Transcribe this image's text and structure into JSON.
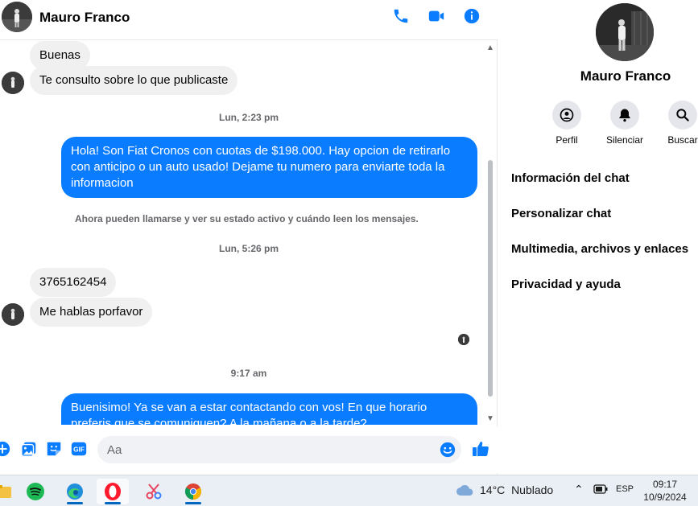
{
  "chat": {
    "contact_name": "Mauro Franco",
    "messages": [
      {
        "dir": "in",
        "text": "Buenas"
      },
      {
        "dir": "in",
        "text": "Te consulto sobre lo que publicaste"
      },
      {
        "type": "time",
        "text": "Lun, 2:23 pm"
      },
      {
        "dir": "out",
        "text": "Hola! Son Fiat Cronos con cuotas de $198.000. Hay opcion de retirarlo con anticipo o un auto usado! Dejame tu numero para enviarte toda la informacion"
      },
      {
        "type": "note",
        "text": "Ahora pueden llamarse y ver su estado activo y cuándo leen los mensajes."
      },
      {
        "type": "time",
        "text": "Lun, 5:26 pm"
      },
      {
        "dir": "in",
        "text": "3765162454"
      },
      {
        "dir": "in",
        "text": "Me hablas porfavor"
      },
      {
        "type": "time",
        "text": "9:17 am"
      },
      {
        "dir": "out",
        "text": "Buenisimo! Ya se van a estar contactando con vos! En que horario preferis que se comuniquen? A la mañana o a la tarde?"
      }
    ],
    "composer": {
      "placeholder": "Aa"
    },
    "icons": {
      "call": "phone-icon",
      "video": "video-camera-icon",
      "info": "info-icon",
      "accent": "#0a7cff"
    }
  },
  "info_panel": {
    "name": "Mauro Franco",
    "actions": [
      {
        "label": "Perfil",
        "icon": "profile-icon"
      },
      {
        "label": "Silenciar",
        "icon": "bell-icon"
      },
      {
        "label": "Buscar",
        "icon": "search-icon"
      }
    ],
    "items": [
      "Información del chat",
      "Personalizar chat",
      "Multimedia, archivos y enlaces",
      "Privacidad y ayuda"
    ]
  },
  "taskbar": {
    "weather": {
      "temp": "14°C",
      "condition": "Nublado"
    },
    "language": "ESP",
    "time": "09:17",
    "date": "10/9/2024"
  }
}
